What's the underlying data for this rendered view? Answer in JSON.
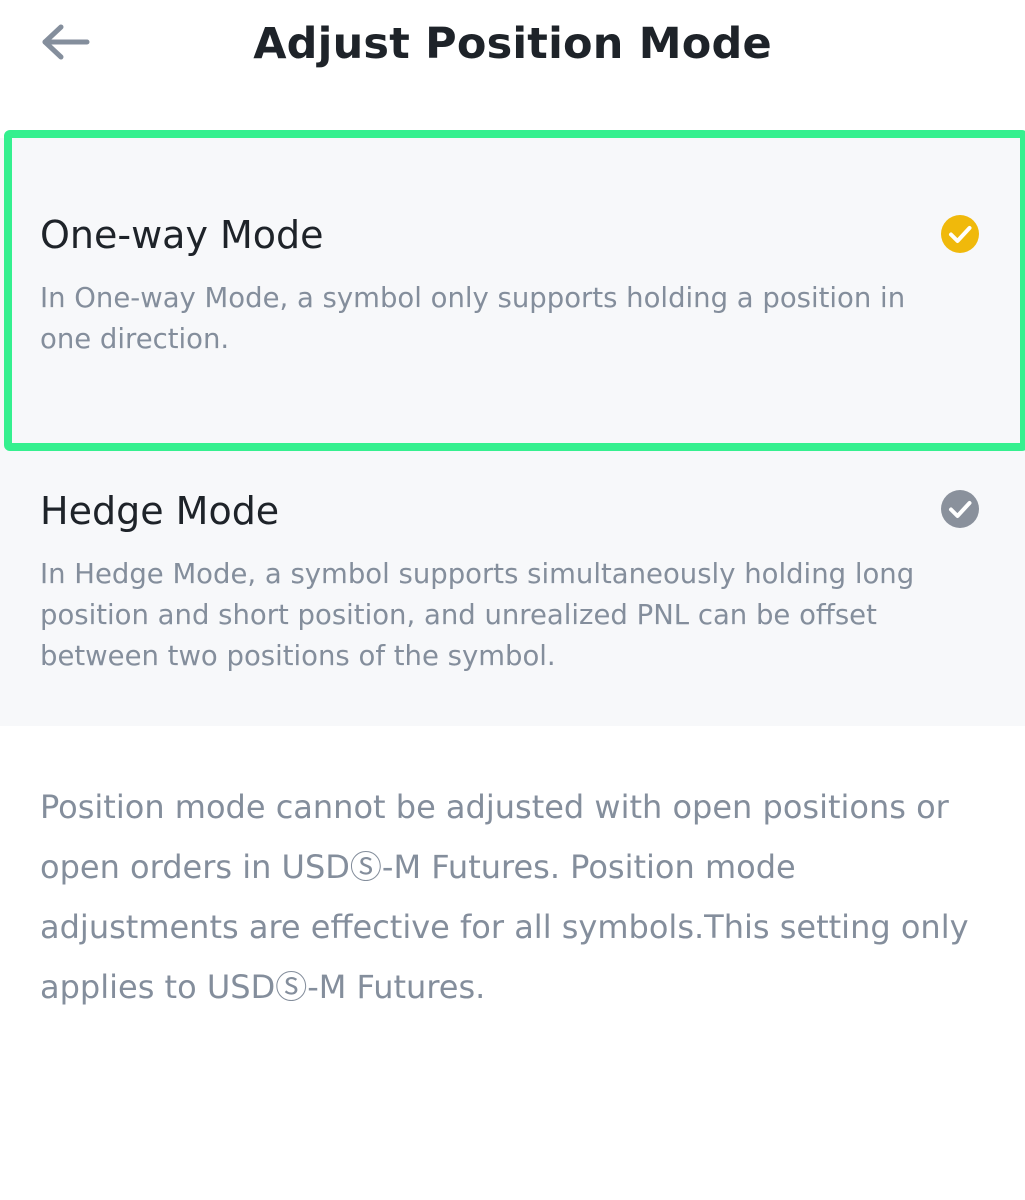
{
  "header": {
    "title": "Adjust Position Mode",
    "back_icon": "arrow-left-icon"
  },
  "options": [
    {
      "title": "One-way Mode",
      "description": "In One-way Mode, a symbol only supports holding a position in one direction.",
      "selected": true,
      "check_color": "#f0b90b"
    },
    {
      "title": "Hedge Mode",
      "description": "In Hedge Mode, a symbol supports simultaneously holding long position and short position, and unrealized PNL can be offset between two positions of the symbol.",
      "selected": false,
      "check_color": "#8a919c"
    }
  ],
  "notice": "Position mode cannot be adjusted with open positions or open orders in USDⓈ-M Futures. Position mode adjustments are effective for all symbols.This setting only applies to USDⓈ-M Futures.",
  "colors": {
    "highlight": "#35f08f",
    "panel_bg": "#f7f8fa",
    "text_primary": "#1e2329",
    "text_secondary": "#848e9c"
  }
}
